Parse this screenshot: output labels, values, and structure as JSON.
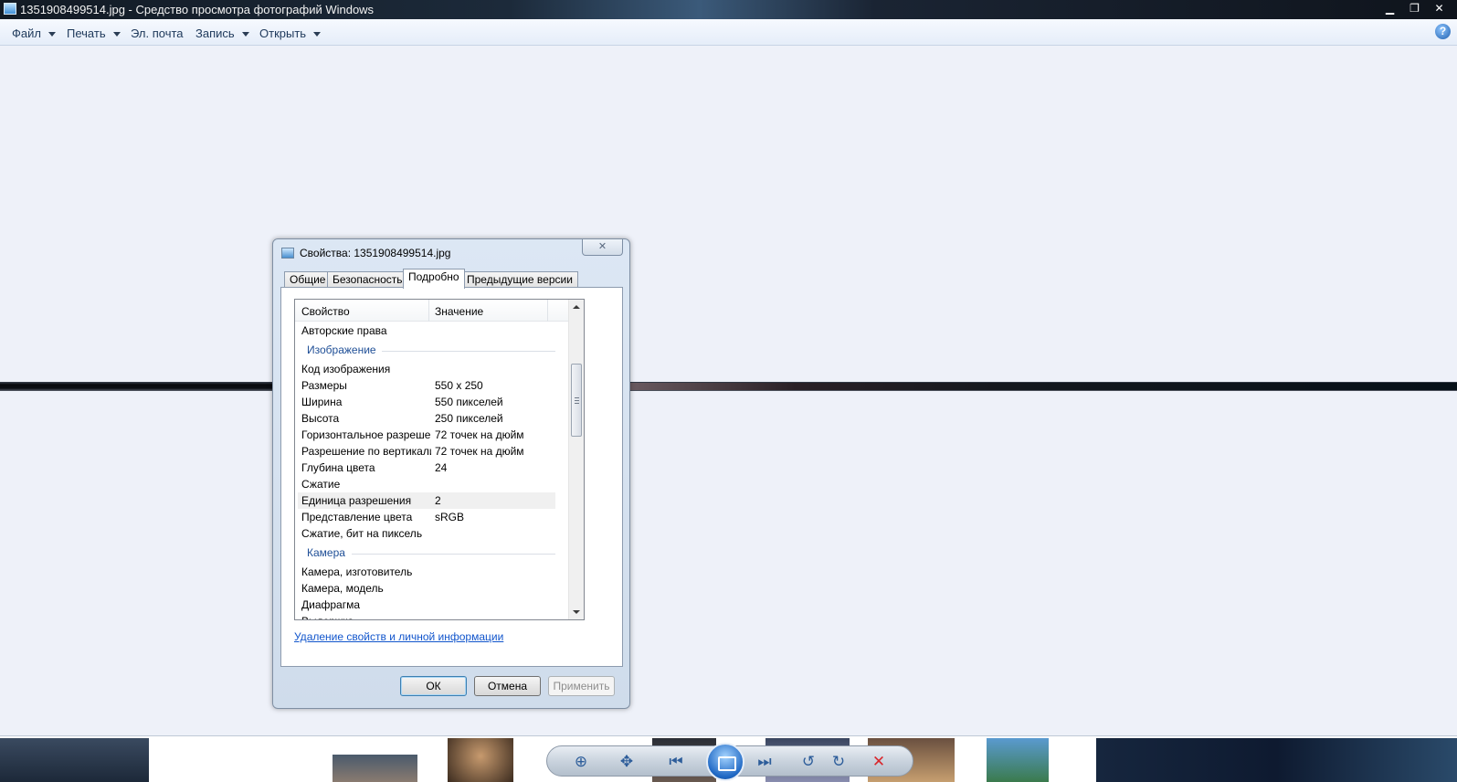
{
  "window": {
    "title": "1351908499514.jpg - Средство просмотра фотографий Windows",
    "controls": {
      "minimize": "▁",
      "maximize": "❐",
      "close": "✕"
    }
  },
  "menu": {
    "items": [
      {
        "label": "Файл",
        "has_dropdown": true
      },
      {
        "label": "Печать",
        "has_dropdown": true
      },
      {
        "label": "Эл. почта",
        "has_dropdown": false
      },
      {
        "label": "Запись",
        "has_dropdown": true
      },
      {
        "label": "Открыть",
        "has_dropdown": true
      }
    ],
    "help": "?"
  },
  "dialog": {
    "title": "Свойства: 1351908499514.jpg",
    "close": "✕",
    "tabs": [
      "Общие",
      "Безопасность",
      "Подробно",
      "Предыдущие версии"
    ],
    "active_tab": "Подробно",
    "columns": {
      "property": "Свойство",
      "value": "Значение"
    },
    "rows": [
      {
        "key": "Авторские права",
        "value": ""
      },
      {
        "group": "Изображение"
      },
      {
        "key": "Код изображения",
        "value": ""
      },
      {
        "key": "Размеры",
        "value": "550 x 250"
      },
      {
        "key": "Ширина",
        "value": "550 пикселей"
      },
      {
        "key": "Высота",
        "value": "250 пикселей"
      },
      {
        "key": "Горизонтальное разреше...",
        "value": "72 точек на дюйм"
      },
      {
        "key": "Разрешение по вертикали",
        "value": "72 точек на дюйм"
      },
      {
        "key": "Глубина цвета",
        "value": "24"
      },
      {
        "key": "Сжатие",
        "value": ""
      },
      {
        "key": "Единица разрешения",
        "value": "2",
        "selected": true
      },
      {
        "key": "Представление цвета",
        "value": "sRGB"
      },
      {
        "key": "Сжатие, бит на пиксель",
        "value": ""
      },
      {
        "group": "Камера"
      },
      {
        "key": "Камера, изготовитель",
        "value": ""
      },
      {
        "key": "Камера, модель",
        "value": ""
      },
      {
        "key": "Диафрагма",
        "value": ""
      },
      {
        "key": "Выдержка",
        "value": ""
      }
    ],
    "link": "Удаление свойств и личной информации",
    "buttons": {
      "ok": "ОК",
      "cancel": "Отмена",
      "apply": "Применить"
    }
  },
  "filmstrip": {
    "controls": {
      "zoom": "⊕",
      "fit": "✥",
      "previous": "⏮",
      "next": "⏭",
      "rotate_ccw": "↺",
      "rotate_cw": "↻",
      "delete": "✕"
    }
  },
  "colors": {
    "accent": "#1e4e96",
    "link": "#1155cc",
    "delete": "#d9262b"
  }
}
